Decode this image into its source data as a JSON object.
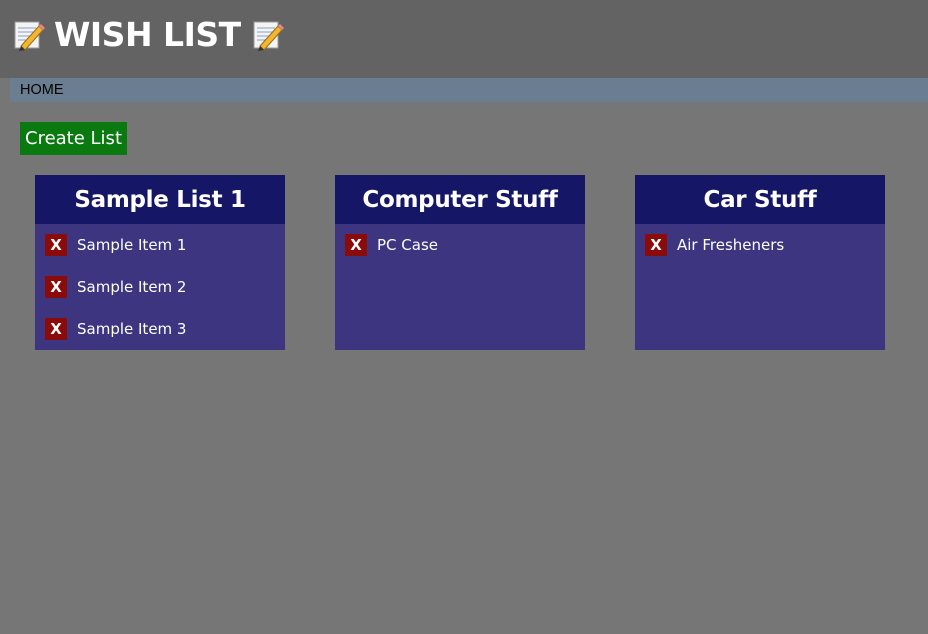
{
  "header": {
    "title": "WISH LIST",
    "left_icon": "memo-icon",
    "right_icon": "memo-icon"
  },
  "nav": {
    "home_label": "HOME"
  },
  "actions": {
    "create_label": "Create List"
  },
  "colors": {
    "background": "#767676",
    "header_bg": "#636363",
    "nav_bg": "#6b7d90",
    "create_button": "#0a7a10",
    "card_header": "#161666",
    "card_body": "#3d3580",
    "delete_button": "#8b0b0b"
  },
  "lists": [
    {
      "title": "Sample List 1",
      "items": [
        {
          "label": "Sample Item 1",
          "delete_label": "X"
        },
        {
          "label": "Sample Item 2",
          "delete_label": "X"
        },
        {
          "label": "Sample Item 3",
          "delete_label": "X"
        }
      ]
    },
    {
      "title": "Computer Stuff",
      "items": [
        {
          "label": "PC Case",
          "delete_label": "X"
        }
      ]
    },
    {
      "title": "Car Stuff",
      "items": [
        {
          "label": "Air Fresheners",
          "delete_label": "X"
        }
      ]
    }
  ]
}
